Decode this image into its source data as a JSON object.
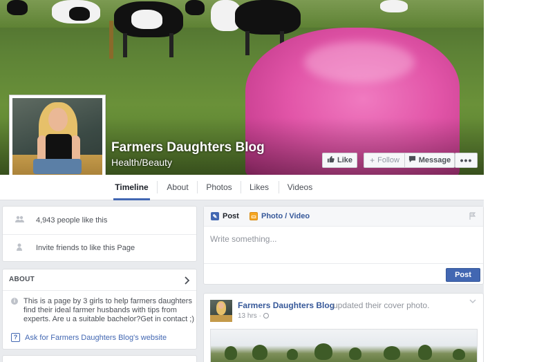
{
  "page": {
    "name": "Farmers Daughters Blog",
    "category": "Health/Beauty"
  },
  "cover_actions": {
    "like": "Like",
    "follow": "Follow",
    "message": "Message",
    "more": "•••"
  },
  "tabs": [
    "Timeline",
    "About",
    "Photos",
    "Likes",
    "Videos"
  ],
  "likes_card": {
    "likes_text": "4,943 people like this",
    "invite_text": "Invite friends to like this Page"
  },
  "about": {
    "title": "ABOUT",
    "description": "This is a page by 3 girls to help farmers daughters find their ideal farmer husbands with tips from experts. Are u a suitable bachelor?Get in contact ;)",
    "ask_link": "Ask for Farmers Daughters Blog's website"
  },
  "composer": {
    "post_tab": "Post",
    "photo_tab": "Photo / Video",
    "placeholder": "Write something...",
    "post_button": "Post"
  },
  "story": {
    "author": "Farmers Daughters Blog",
    "action": "updated their cover photo.",
    "time": "13 hrs ·"
  },
  "colors": {
    "brand_blue": "#4267b2",
    "link_blue": "#365899",
    "background": "#e9ebee"
  },
  "icons": {
    "like": "thumbs-up-icon",
    "follow": "plus-icon",
    "message": "speech-bubble-icon",
    "likes_row": "people-icon",
    "invite_row": "person-add-icon",
    "about_chevron": "chevron-right-icon",
    "info": "info-icon",
    "ask": "question-icon",
    "post_tab": "pencil-icon",
    "photo_tab": "photo-icon",
    "flag": "flag-icon",
    "globe": "globe-icon",
    "story_menu": "chevron-down-icon"
  }
}
